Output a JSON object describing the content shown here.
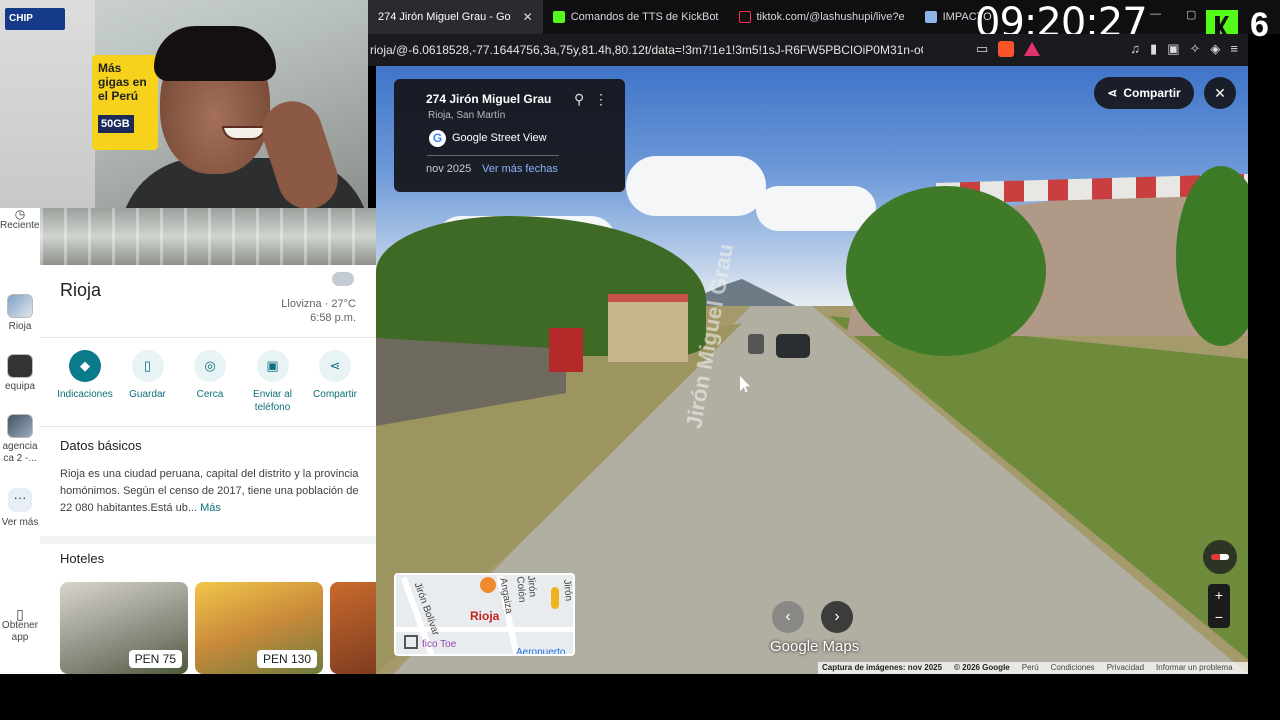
{
  "browser": {
    "tabs": [
      {
        "label": "274 Jirón Miguel Grau - Go",
        "active": true,
        "close": "✕"
      },
      {
        "label": "Comandos de TTS de KickBot",
        "active": false
      },
      {
        "label": "tiktok.com/@lashushupi/live?e",
        "active": false
      },
      {
        "label": "IMPACTO",
        "active": false
      }
    ],
    "url": "rioja/@-6.0618528,-77.1644756,3a,75y,81.4h,80.12t/data=!3m7!1e1!3m5!1sJ-R6FW5PBCIOiP0M31n-oQ!2e0!...",
    "clock": "09:20:27",
    "kick_count": "6",
    "colors": {
      "kick_green": "#53fc18",
      "brave_orange": "#fb542b"
    }
  },
  "webcam": {
    "sign_text": "Más gigas en el Perú",
    "sign_badge": "50GB",
    "chip_label": "CHIP"
  },
  "rail": {
    "items": [
      {
        "label": "Recientes",
        "icon": "history-icon"
      },
      {
        "label": "Rioja",
        "icon": "place-thumb"
      },
      {
        "label": "equipa",
        "icon": "place-thumb"
      },
      {
        "label": "agencia ca 2 -...",
        "icon": "place-thumb"
      },
      {
        "label": "Ver más",
        "icon": "more-dots-icon"
      },
      {
        "label": "Obtener app",
        "icon": "phone-icon"
      }
    ]
  },
  "panel": {
    "title": "Rioja",
    "weather": {
      "condition": "Llovizna",
      "temp": "27°C",
      "time": "6:58 p.m."
    },
    "actions": [
      {
        "label": "Indicaciones",
        "icon": "directions-icon"
      },
      {
        "label": "Guardar",
        "icon": "bookmark-icon"
      },
      {
        "label": "Cerca",
        "icon": "nearby-icon"
      },
      {
        "label": "Enviar al teléfono",
        "icon": "send-to-phone-icon"
      },
      {
        "label": "Compartir",
        "icon": "share-icon"
      }
    ],
    "basics_title": "Datos básicos",
    "description": "Rioja es una ciudad peruana, capital del distrito y la provincia homónimos. Según el censo de 2017, tiene una población de 22 080 habitantes.Está ub...",
    "more_link": "Más",
    "hotels_title": "Hoteles",
    "hotels": [
      {
        "price": "PEN 75"
      },
      {
        "price": "PEN 130"
      }
    ]
  },
  "streetview": {
    "card": {
      "title": "274 Jirón Miguel Grau",
      "subtitle": "Rioja, San Martín",
      "provider": "Google Street View",
      "date": "nov 2025",
      "more_dates": "Ver más fechas"
    },
    "share_label": "Compartir",
    "road_text": "Jirón Miguel Grau",
    "brand": "Google Maps",
    "footer": {
      "capture": "Captura de imágenes: nov 2025",
      "copyright": "© 2026 Google",
      "country": "Perú",
      "terms": "Condiciones",
      "privacy": "Privacidad",
      "report": "Informar un problema"
    },
    "minimap": {
      "city": "Rioja",
      "streets": [
        "Jirón Bolívar",
        "Angaiza",
        "Jirón Colón",
        "Jirón"
      ],
      "poi": "fico Toe",
      "other": "Aeropuerto"
    }
  }
}
